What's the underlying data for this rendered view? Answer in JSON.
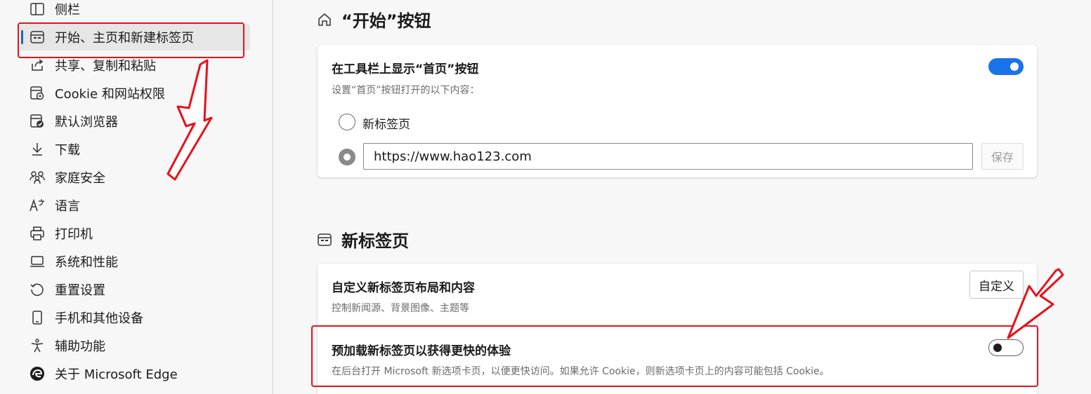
{
  "sidebar": {
    "items": [
      {
        "label": "侧栏",
        "icon": "sidebar-icon",
        "active": false
      },
      {
        "label": "开始、主页和新建标签页",
        "icon": "new-tab-icon",
        "active": true
      },
      {
        "label": "共享、复制和粘贴",
        "icon": "share-icon",
        "active": false
      },
      {
        "label": "Cookie 和网站权限",
        "icon": "site-permissions-icon",
        "active": false
      },
      {
        "label": "默认浏览器",
        "icon": "default-browser-icon",
        "active": false
      },
      {
        "label": "下载",
        "icon": "download-icon",
        "active": false
      },
      {
        "label": "家庭安全",
        "icon": "family-icon",
        "active": false
      },
      {
        "label": "语言",
        "icon": "language-icon",
        "active": false
      },
      {
        "label": "打印机",
        "icon": "printer-icon",
        "active": false
      },
      {
        "label": "系统和性能",
        "icon": "laptop-icon",
        "active": false
      },
      {
        "label": "重置设置",
        "icon": "reset-icon",
        "active": false
      },
      {
        "label": "手机和其他设备",
        "icon": "phone-icon",
        "active": false
      },
      {
        "label": "辅助功能",
        "icon": "accessibility-icon",
        "active": false
      },
      {
        "label": "关于 Microsoft Edge",
        "icon": "edge-logo-icon",
        "active": false
      }
    ]
  },
  "home_section": {
    "title": "“开始”按钮",
    "icon": "home-icon",
    "show_home_title": "在工具栏上显示“首页”按钮",
    "show_home_enabled": true,
    "set_home_sub": "设置“首页”按钮打开的以下内容：",
    "option_new_tab": "新标签页",
    "url_value": "https://www.hao123.com",
    "selected_option": "url",
    "save_label": "保存"
  },
  "newtab_section": {
    "title": "新标签页",
    "icon": "new-tab-icon",
    "customize_title": "自定义新标签页布局和内容",
    "customize_sub": "控制新闻源、背景图像、主题等",
    "customize_button": "自定义",
    "preload_title": "预加载新标签页以获得更快的体验",
    "preload_sub": "在后台打开 Microsoft 新选项卡页，以便更快访问。如果允许 Cookie，则新选项卡页上的内容可能包括 Cookie。",
    "preload_enabled": false
  },
  "colors": {
    "accent": "#1a73e8",
    "annotation_red": "#e8101a",
    "active_indicator": "#0f6cbd"
  }
}
